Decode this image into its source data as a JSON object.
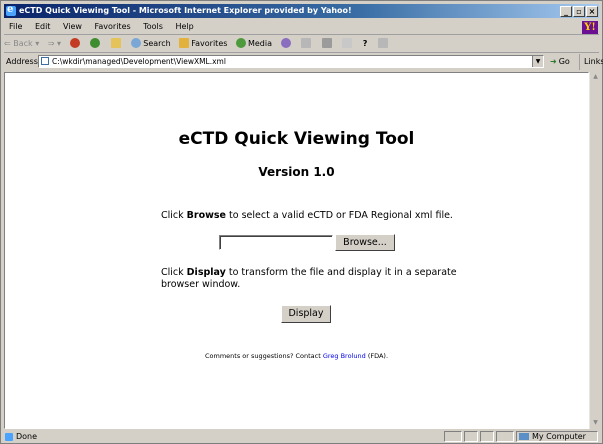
{
  "window": {
    "title": "eCTD Quick Viewing Tool - Microsoft Internet Explorer provided by Yahoo!",
    "minimize_glyph": "_",
    "maximize_glyph": "▫",
    "close_glyph": "×"
  },
  "menu": {
    "items": [
      "File",
      "Edit",
      "View",
      "Favorites",
      "Tools",
      "Help"
    ],
    "brand_logo": "Y!"
  },
  "toolbar": {
    "back": "⇐ Back",
    "back_drop": "▾",
    "forward": "⇒",
    "forward_drop": "▾",
    "search": "Search",
    "favorites": "Favorites",
    "media": "Media",
    "help_glyph": "?"
  },
  "address": {
    "label": "Address",
    "value": "C:\\wkdir\\managed\\Development\\ViewXML.xml",
    "dropdown_glyph": "▼",
    "go_label": "Go",
    "links_label": "Links"
  },
  "page": {
    "title": "eCTD Quick Viewing Tool",
    "version": "Version 1.0",
    "instr1_pre": "Click ",
    "instr1_bold": "Browse",
    "instr1_post": " to select a valid eCTD or FDA Regional xml file.",
    "file_value": "",
    "browse_label": "Browse...",
    "instr2_pre": "Click ",
    "instr2_bold": "Display",
    "instr2_post": " to transform the file and display it in a separate browser window.",
    "display_label": "Display",
    "comments_pre": "Comments or suggestions? Contact ",
    "contact_name": "Greg Brolund",
    "comments_post": " (FDA)."
  },
  "status": {
    "text": "Done",
    "zone": "My Computer"
  },
  "scrollbar": {
    "up_glyph": "▲",
    "down_glyph": "▼"
  },
  "colors": {
    "titlebar_start": "#0a246a",
    "chrome": "#d4d0c8",
    "link": "#0000ee"
  }
}
